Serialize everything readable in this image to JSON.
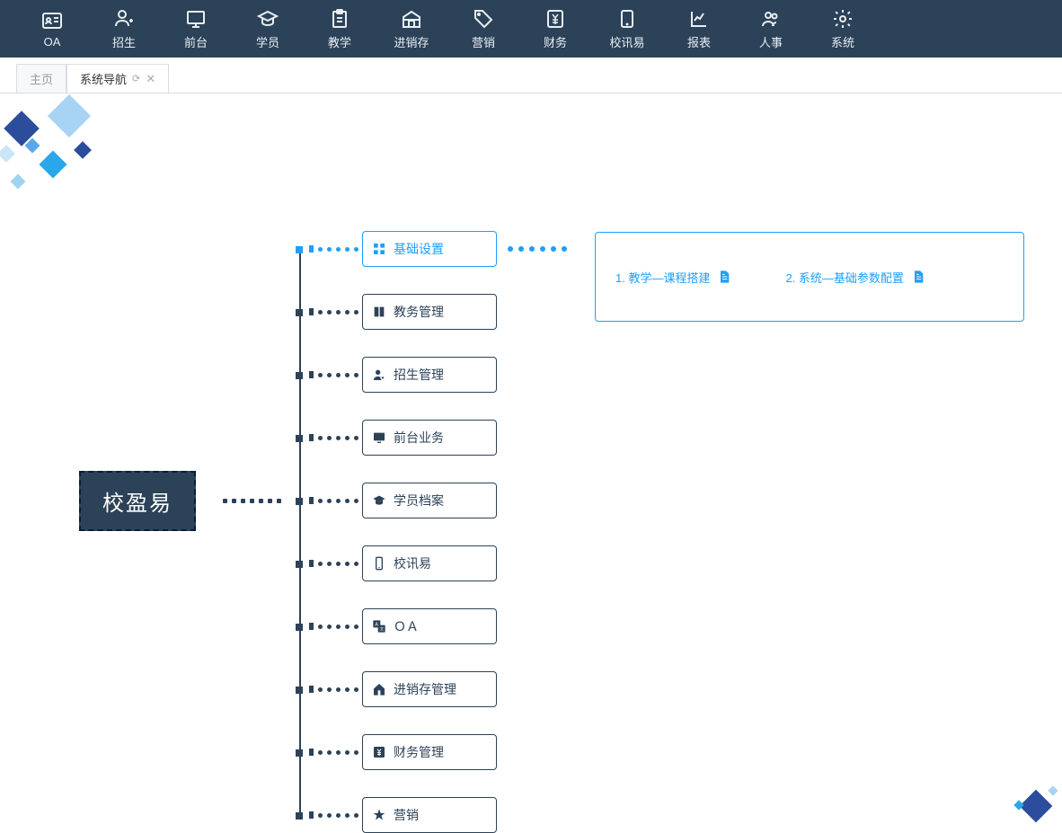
{
  "topnav": [
    {
      "label": "OA",
      "icon": "id-card"
    },
    {
      "label": "招生",
      "icon": "person-add"
    },
    {
      "label": "前台",
      "icon": "monitor"
    },
    {
      "label": "学员",
      "icon": "graduation"
    },
    {
      "label": "教学",
      "icon": "clipboard"
    },
    {
      "label": "进销存",
      "icon": "warehouse"
    },
    {
      "label": "营销",
      "icon": "tag"
    },
    {
      "label": "财务",
      "icon": "yen"
    },
    {
      "label": "校讯易",
      "icon": "tablet"
    },
    {
      "label": "报表",
      "icon": "chart"
    },
    {
      "label": "人事",
      "icon": "people"
    },
    {
      "label": "系统",
      "icon": "gear"
    }
  ],
  "tabs": [
    {
      "label": "主页",
      "active": false,
      "closable": false
    },
    {
      "label": "系统导航",
      "active": true,
      "closable": true
    }
  ],
  "root": {
    "label": "校盈易"
  },
  "categories": [
    {
      "label": "基础设置",
      "icon": "grid",
      "active": true
    },
    {
      "label": "教务管理",
      "icon": "book",
      "active": false
    },
    {
      "label": "招生管理",
      "icon": "person-plus",
      "active": false
    },
    {
      "label": "前台业务",
      "icon": "monitor-sm",
      "active": false
    },
    {
      "label": "学员档案",
      "icon": "graduation-sm",
      "active": false
    },
    {
      "label": "校讯易",
      "icon": "mobile",
      "active": false
    },
    {
      "label": "ＯＡ",
      "icon": "translate",
      "active": false
    },
    {
      "label": "进销存管理",
      "icon": "home",
      "active": false
    },
    {
      "label": "财务管理",
      "icon": "yen-sm",
      "active": false
    },
    {
      "label": "营销",
      "icon": "star",
      "active": false
    }
  ],
  "details": [
    {
      "label": "1. 教学—课程搭建"
    },
    {
      "label": "2. 系统—基础参数配置"
    }
  ],
  "colors": {
    "accent": "#1e9fff",
    "dark": "#2c4258"
  }
}
